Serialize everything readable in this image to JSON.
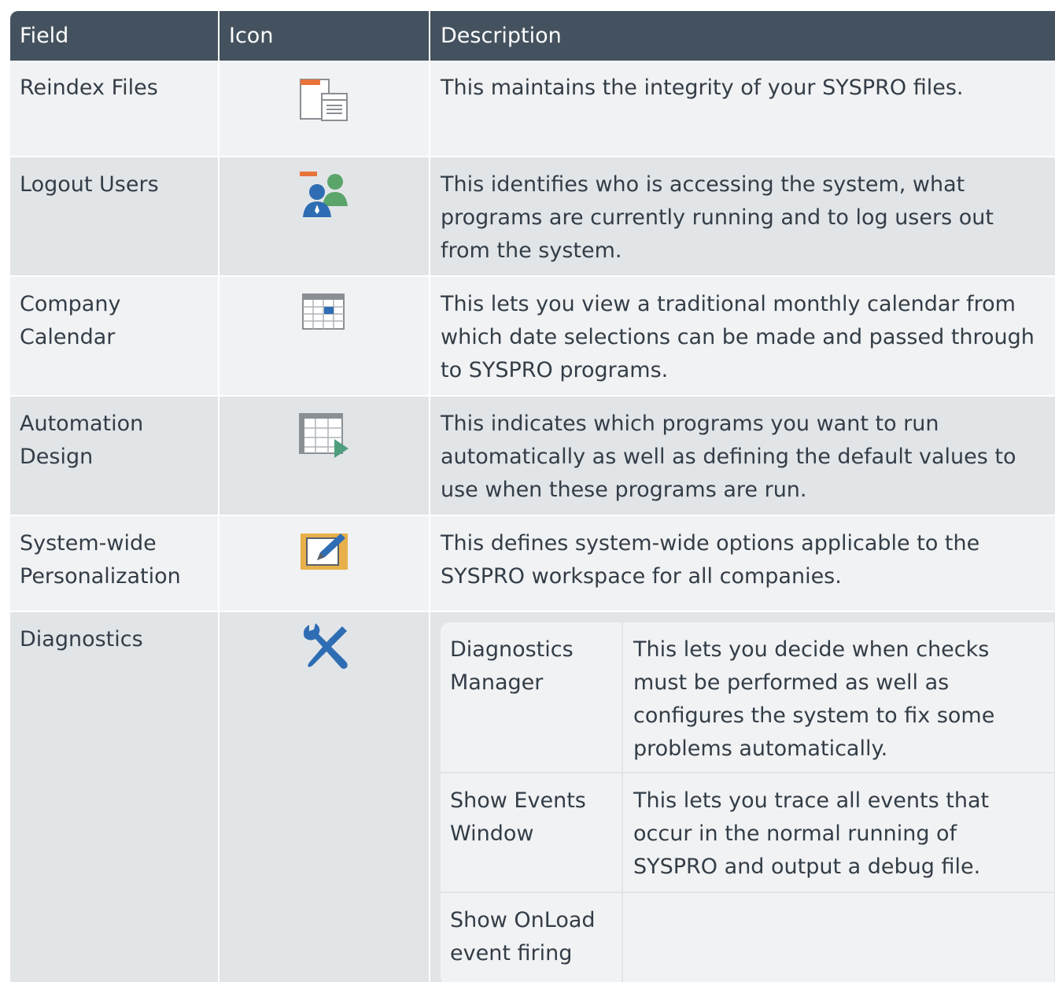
{
  "headers": {
    "field": "Field",
    "icon": "Icon",
    "description": "Description"
  },
  "rows": [
    {
      "field": "Reindex Files",
      "icon": "reindex-files-icon",
      "description": "This maintains the integrity of your SYSPRO files."
    },
    {
      "field": "Logout Users",
      "icon": "logout-users-icon",
      "description": "This identifies who is accessing the system, what programs are currently running and to log users out from the system."
    },
    {
      "field": "Company Calendar",
      "icon": "calendar-icon",
      "description": "This lets you view a traditional monthly calendar from which date selections can be made and passed through to SYSPRO programs."
    },
    {
      "field": "Automation Design",
      "icon": "automation-design-icon",
      "description": "This indicates which programs you want to run automatically as well as defining the default values to use when these programs are run."
    },
    {
      "field": "System-wide Personalization",
      "icon": "personalization-icon",
      "description": "This defines system-wide options applicable to the SYSPRO workspace for all companies."
    },
    {
      "field": "Diagnostics",
      "icon": "wrench-screwdriver-icon",
      "subrows": [
        {
          "option": "Diagnostics Manager",
          "description": "This lets you decide when checks must be performed as well as configures the system to fix some problems automatically."
        },
        {
          "option": "Show Events Window",
          "description": "This lets you trace all events that occur in the normal running of SYSPRO and output a debug file."
        },
        {
          "option": "Show OnLoad event firing",
          "description": ""
        }
      ]
    }
  ],
  "colors": {
    "header": "#44525f",
    "row_light": "#f1f2f3",
    "row_dark": "#e2e5e8",
    "text": "#333d47"
  }
}
